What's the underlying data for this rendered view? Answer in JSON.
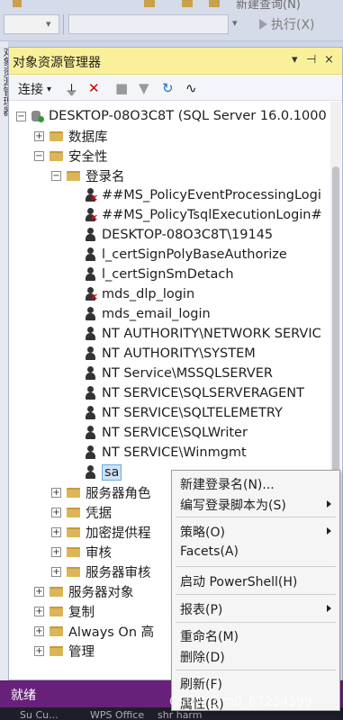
{
  "toolbar": {
    "new_query_label": "新建查询(N)",
    "execute_label": "执行(X)"
  },
  "side_tab": {
    "label": "对象资源管理器"
  },
  "panel": {
    "title": "对象资源管理器",
    "pin": "▾ ⊣ ×",
    "connect_label": "连接",
    "tools": [
      "plug-icon",
      "disconnect-icon",
      "stop-icon",
      "filter-icon",
      "refresh-icon",
      "activity-icon"
    ]
  },
  "tree": {
    "server": "DESKTOP-08O3C8T (SQL Server 16.0.1000",
    "databases": "数据库",
    "security": "安全性",
    "logins": "登录名",
    "login_items": [
      "##MS_PolicyEventProcessingLogi",
      "##MS_PolicyTsqlExecutionLogin#",
      "DESKTOP-08O3C8T\\19145",
      "l_certSignPolyBaseAuthorize",
      "l_certSignSmDetach",
      "mds_dlp_login",
      "mds_email_login",
      "NT AUTHORITY\\NETWORK SERVIC",
      "NT AUTHORITY\\SYSTEM",
      "NT Service\\MSSQLSERVER",
      "NT SERVICE\\SQLSERVERAGENT",
      "NT SERVICE\\SQLTELEMETRY",
      "NT SERVICE\\SQLWriter",
      "NT SERVICE\\Winmgmt",
      "sa"
    ],
    "server_roles": "服务器角色",
    "credentials": "凭据",
    "crypto_providers": "加密提供程",
    "audits": "审核",
    "server_audit_specs": "服务器审核",
    "server_objects": "服务器对象",
    "replication": "复制",
    "always_on": "Always On 高",
    "management": "管理"
  },
  "context_menu": {
    "items": [
      {
        "label": "新建登录名(N)..."
      },
      {
        "label": "编写登录脚本为(S)"
      },
      {
        "label": "策略(O)"
      },
      {
        "label": "Facets(A)"
      },
      {
        "label": "启动 PowerShell(H)"
      },
      {
        "label": "报表(P)"
      },
      {
        "label": "重命名(M)"
      },
      {
        "label": "删除(D)"
      },
      {
        "label": "刷新(F)"
      },
      {
        "label": "属性(R)"
      }
    ]
  },
  "status": {
    "text": "就绪"
  },
  "taskbar": {
    "items": [
      "Su Cu...",
      "WPS Office",
      "shr harm"
    ]
  },
  "watermark": "CSDN @m0_67234599",
  "colors": {
    "title_bar": "#fbf09a",
    "status_bar": "#68217a",
    "selection": "#cce4f7"
  }
}
